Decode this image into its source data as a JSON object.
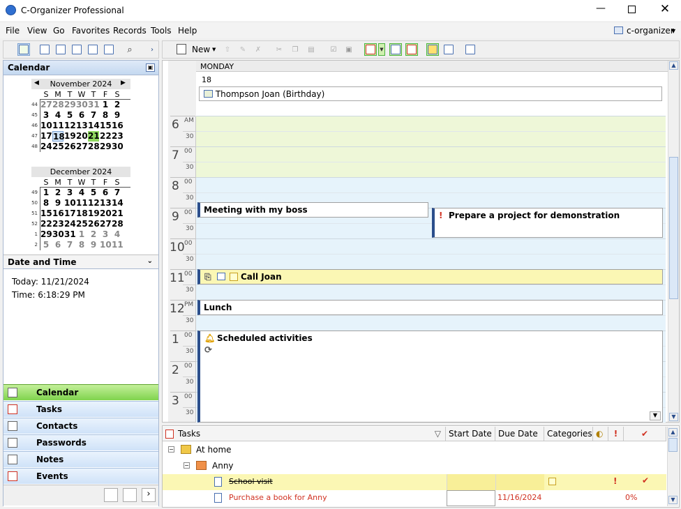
{
  "window": {
    "title": "C-Organizer Professional"
  },
  "menu": {
    "items": [
      "File",
      "View",
      "Go",
      "Favorites",
      "Records",
      "Tools",
      "Help"
    ],
    "user": "c-organizer"
  },
  "toolbar": {
    "new_label": "New"
  },
  "calendar_pane": {
    "title": "Calendar"
  },
  "mini_calendars": [
    {
      "title": "November 2024",
      "dow": [
        "S",
        "M",
        "T",
        "W",
        "T",
        "F",
        "S"
      ],
      "weeks": [
        {
          "wk": "44",
          "days": [
            "27",
            "28",
            "29",
            "30",
            "31",
            "1",
            "2"
          ],
          "other": [
            1,
            1,
            1,
            1,
            1,
            0,
            0
          ]
        },
        {
          "wk": "45",
          "days": [
            "3",
            "4",
            "5",
            "6",
            "7",
            "8",
            "9"
          ],
          "other": [
            0,
            0,
            0,
            0,
            0,
            0,
            0
          ]
        },
        {
          "wk": "46",
          "days": [
            "10",
            "11",
            "12",
            "13",
            "14",
            "15",
            "16"
          ],
          "other": [
            0,
            0,
            0,
            0,
            0,
            0,
            0
          ]
        },
        {
          "wk": "47",
          "days": [
            "17",
            "18",
            "19",
            "20",
            "21",
            "22",
            "23"
          ],
          "other": [
            0,
            0,
            0,
            0,
            0,
            0,
            0
          ]
        },
        {
          "wk": "48",
          "days": [
            "24",
            "25",
            "26",
            "27",
            "28",
            "29",
            "30"
          ],
          "other": [
            0,
            0,
            0,
            0,
            0,
            0,
            0
          ]
        }
      ],
      "today": "21",
      "selected": "18"
    },
    {
      "title": "December 2024",
      "dow": [
        "S",
        "M",
        "T",
        "W",
        "T",
        "F",
        "S"
      ],
      "weeks": [
        {
          "wk": "49",
          "days": [
            "1",
            "2",
            "3",
            "4",
            "5",
            "6",
            "7"
          ],
          "other": [
            0,
            0,
            0,
            0,
            0,
            0,
            0
          ]
        },
        {
          "wk": "50",
          "days": [
            "8",
            "9",
            "10",
            "11",
            "12",
            "13",
            "14"
          ],
          "other": [
            0,
            0,
            0,
            0,
            0,
            0,
            0
          ]
        },
        {
          "wk": "51",
          "days": [
            "15",
            "16",
            "17",
            "18",
            "19",
            "20",
            "21"
          ],
          "other": [
            0,
            0,
            0,
            0,
            0,
            0,
            0
          ]
        },
        {
          "wk": "52",
          "days": [
            "22",
            "23",
            "24",
            "25",
            "26",
            "27",
            "28"
          ],
          "other": [
            0,
            0,
            0,
            0,
            0,
            0,
            0
          ]
        },
        {
          "wk": "1",
          "days": [
            "29",
            "30",
            "31",
            "1",
            "2",
            "3",
            "4"
          ],
          "other": [
            0,
            0,
            0,
            1,
            1,
            1,
            1
          ]
        },
        {
          "wk": "2",
          "days": [
            "5",
            "6",
            "7",
            "8",
            "9",
            "10",
            "11"
          ],
          "other": [
            1,
            1,
            1,
            1,
            1,
            1,
            1
          ]
        }
      ]
    }
  ],
  "datetime": {
    "title": "Date and Time",
    "today": "Today: 11/21/2024",
    "time": "Time: 6:18:29 PM"
  },
  "nav": [
    "Calendar",
    "Tasks",
    "Contacts",
    "Passwords",
    "Notes",
    "Events"
  ],
  "day_view": {
    "weekday": "MONDAY",
    "date": "18",
    "all_day_event": "Thompson Joan (Birthday)",
    "hours": [
      {
        "h": "6",
        "suffix": "AM"
      },
      {
        "h": "7",
        "suffix": "00"
      },
      {
        "h": "8",
        "suffix": "00"
      },
      {
        "h": "9",
        "suffix": "00"
      },
      {
        "h": "10",
        "suffix": "00"
      },
      {
        "h": "11",
        "suffix": "00"
      },
      {
        "h": "12",
        "suffix": "PM"
      },
      {
        "h": "1",
        "suffix": "00"
      },
      {
        "h": "2",
        "suffix": "00"
      },
      {
        "h": "3",
        "suffix": "00"
      }
    ],
    "half": "30",
    "appointments": {
      "meeting": "Meeting with my boss",
      "project": "Prepare a project for demonstration",
      "call": "Call Joan",
      "lunch": "Lunch",
      "scheduled": "Scheduled activities"
    }
  },
  "tasks": {
    "columns": {
      "name": "Tasks",
      "start": "Start Date",
      "due": "Due Date",
      "categories": "Categories"
    },
    "rows": [
      {
        "name": "At home",
        "start": "",
        "due": "",
        "progress": ""
      },
      {
        "name": "Anny",
        "start": "",
        "due": "",
        "progress": ""
      },
      {
        "name": "School visit",
        "start": "",
        "due": "",
        "progress": ""
      },
      {
        "name": "Purchase a book for Anny",
        "start": "",
        "due": "11/16/2024",
        "progress": "0%"
      }
    ]
  },
  "colors": {
    "accent": "#2b4e8c",
    "today": "#90d860",
    "workhours": "#eef7d8",
    "afterhours": "#e6f3fb",
    "overdue": "#d03020",
    "highlight": "#fbf7b4"
  }
}
